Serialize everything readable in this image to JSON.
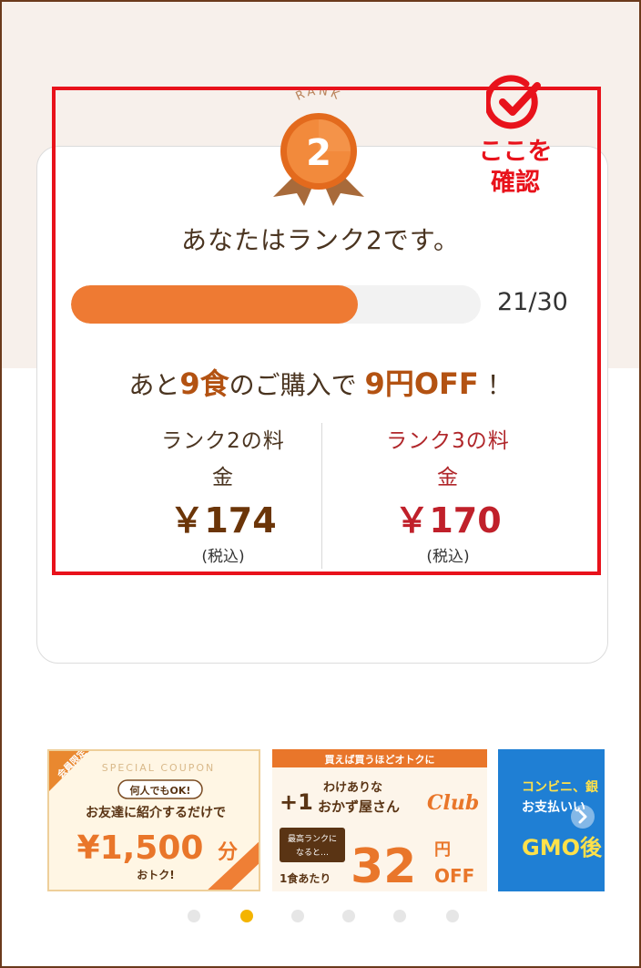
{
  "rank": {
    "medal_label": "RANK",
    "medal_number": "2",
    "message": "あなたはランク2です。",
    "progress_fraction": 0.7,
    "progress_count": "21/30",
    "offer_prefix": "あと",
    "offer_meals": "9食",
    "offer_middle": "のご購入で",
    "offer_discount": "9円OFF",
    "offer_suffix": "！"
  },
  "prices": {
    "current": {
      "label_line1": "ランク2の料",
      "label_line2": "金",
      "value": "￥174",
      "tax": "(税込)"
    },
    "next": {
      "label_line1": "ランク3の料",
      "label_line2": "金",
      "value": "￥170",
      "tax": "(税込)"
    }
  },
  "annotation": {
    "check_label_line1": "ここを",
    "check_label_line2": "確認",
    "color": "#e8121b"
  },
  "banners": {
    "coupon": {
      "ribbon": "会員限定",
      "header": "SPECIAL COUPON",
      "pill": "何人でもOK!",
      "line": "お友達に紹介するだけで",
      "amount": "¥1,500",
      "unit": "分",
      "footer": "おトク!"
    },
    "club": {
      "header": "買えば買うほどオトクに",
      "plus": "+1",
      "title_line1": "わけありな",
      "title_line2": "おかず屋さん",
      "club_word": "Club",
      "badge_line1": "最高ランクに",
      "badge_line2": "なると…",
      "per_meal": "1食あたり",
      "amount": "32",
      "yen": "円",
      "off": "OFF"
    },
    "gmo": {
      "line1": "コンビニ、銀",
      "line2": "お支払いい",
      "line3": "GMO後"
    }
  },
  "carousel": {
    "dot_count": 6,
    "active_index": 1
  },
  "colors": {
    "accent": "#ee7a33",
    "brown": "#6b3508",
    "red": "#c0202a",
    "highlight": "#e8121b"
  }
}
